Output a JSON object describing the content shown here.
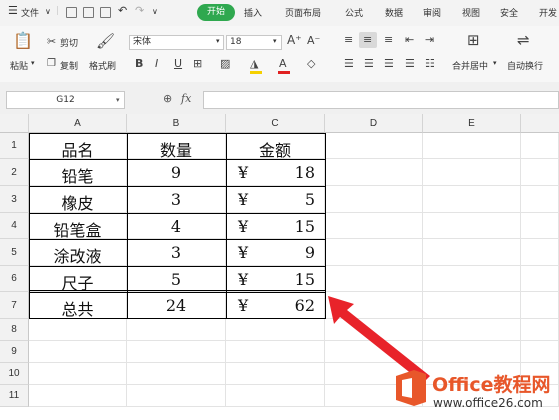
{
  "menubar": {
    "file_label": "文件",
    "tabs": [
      "开始",
      "插入",
      "页面布局",
      "公式",
      "数据",
      "审阅",
      "视图",
      "安全",
      "开发"
    ]
  },
  "ribbon": {
    "paste": "粘贴",
    "cut": "剪切",
    "copy": "复制",
    "format_painter": "格式刷",
    "font_name": "宋体",
    "font_size": "18",
    "merge_center": "合并居中",
    "wrap_text": "自动换行"
  },
  "formula_bar": {
    "cell_ref": "G12",
    "fx": "fx",
    "formula": ""
  },
  "columns": [
    "A",
    "B",
    "C",
    "D",
    "E"
  ],
  "rows": [
    "1",
    "2",
    "3",
    "4",
    "5",
    "6",
    "7",
    "8",
    "9",
    "10",
    "11"
  ],
  "table": {
    "header": [
      "品名",
      "数量",
      "金额"
    ],
    "currency": "¥",
    "rows": [
      {
        "name": "铅笔",
        "qty": "9",
        "amount": "18"
      },
      {
        "name": "橡皮",
        "qty": "3",
        "amount": "5"
      },
      {
        "name": "铅笔盒",
        "qty": "4",
        "amount": "15"
      },
      {
        "name": "涂改液",
        "qty": "3",
        "amount": "9"
      },
      {
        "name": "尺子",
        "qty": "5",
        "amount": "15"
      }
    ],
    "total": {
      "name": "总共",
      "qty": "24",
      "amount": "62"
    }
  },
  "watermark": {
    "brand": "Office教程网",
    "url": "www.office26.com",
    "arrow_color": "#e8232a",
    "logo_color": "#e8572a"
  }
}
